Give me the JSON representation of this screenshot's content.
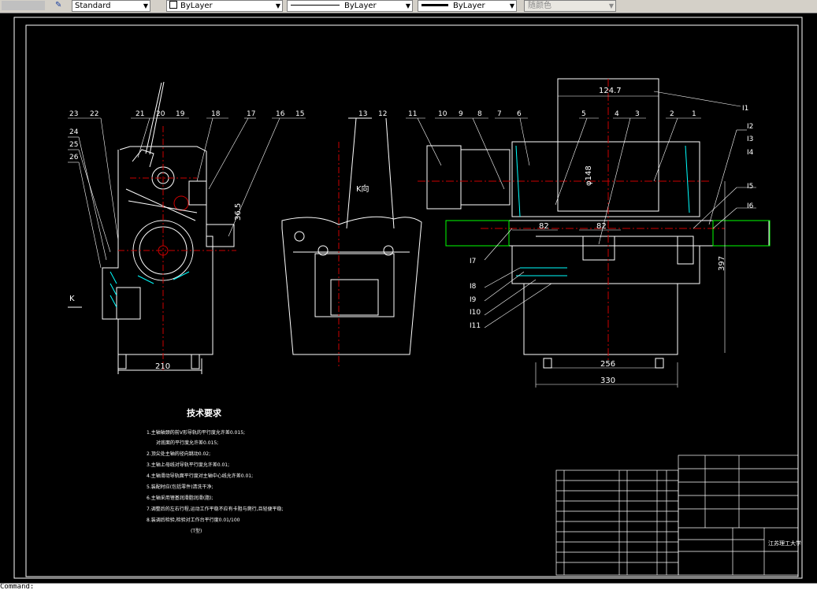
{
  "toolbar": {
    "text_style": "Standard",
    "layer": "ByLayer",
    "linetype": "ByLayer",
    "lineweight": "ByLayer",
    "plot_style": "随颜色"
  },
  "drawing": {
    "part_labels_left": [
      "23",
      "22",
      "21",
      "20",
      "19",
      "18",
      "17",
      "16",
      "15",
      "24",
      "25",
      "26"
    ],
    "part_labels_mid": [
      "13",
      "12"
    ],
    "part_labels_right_top": [
      "11",
      "10",
      "9",
      "8",
      "7",
      "6",
      "5",
      "4",
      "3",
      "2",
      "1"
    ],
    "part_labels_right_side": [
      "I1",
      "I2",
      "I3",
      "I4",
      "I5",
      "I6"
    ],
    "part_labels_right_bottom": [
      "I7",
      "I8",
      "I9",
      "I10",
      "I11"
    ],
    "dims": {
      "d210": "210",
      "d36_5": "36.5",
      "d124_7": "124.7",
      "d148": "φ148",
      "d82a": "82",
      "d82b": "82",
      "d397": "397",
      "d256": "256",
      "d330": "330"
    },
    "view_label_k": "K",
    "view_label_kdir": "K向",
    "title_block_school": "江苏理工大学"
  },
  "tech_requirements": {
    "title": "技术要求",
    "lines": [
      "1.主轴轴颈的前V形导轨的平行度允许差0.015;",
      "对底面的平行度允许差0.015;",
      "2.顶尖处主轴的径向跳动0.02;",
      "3.主轴上母线对导轨平行度允许差0.01;",
      "4.主轴滑动导轨面平行度对主轴中心线允许差0.01;",
      "5.装配时应(包括零件)清洗干净;",
      "6.主轴采用锂基润滑脂润滑(脂);",
      "7.调整后的左右行程,运动工作平稳不应有卡阻与爬行,且轻便平稳;",
      "8.装调后检验,检验对工作台平行度0.01/100",
      "(T型)"
    ]
  },
  "command_line": "Command:"
}
